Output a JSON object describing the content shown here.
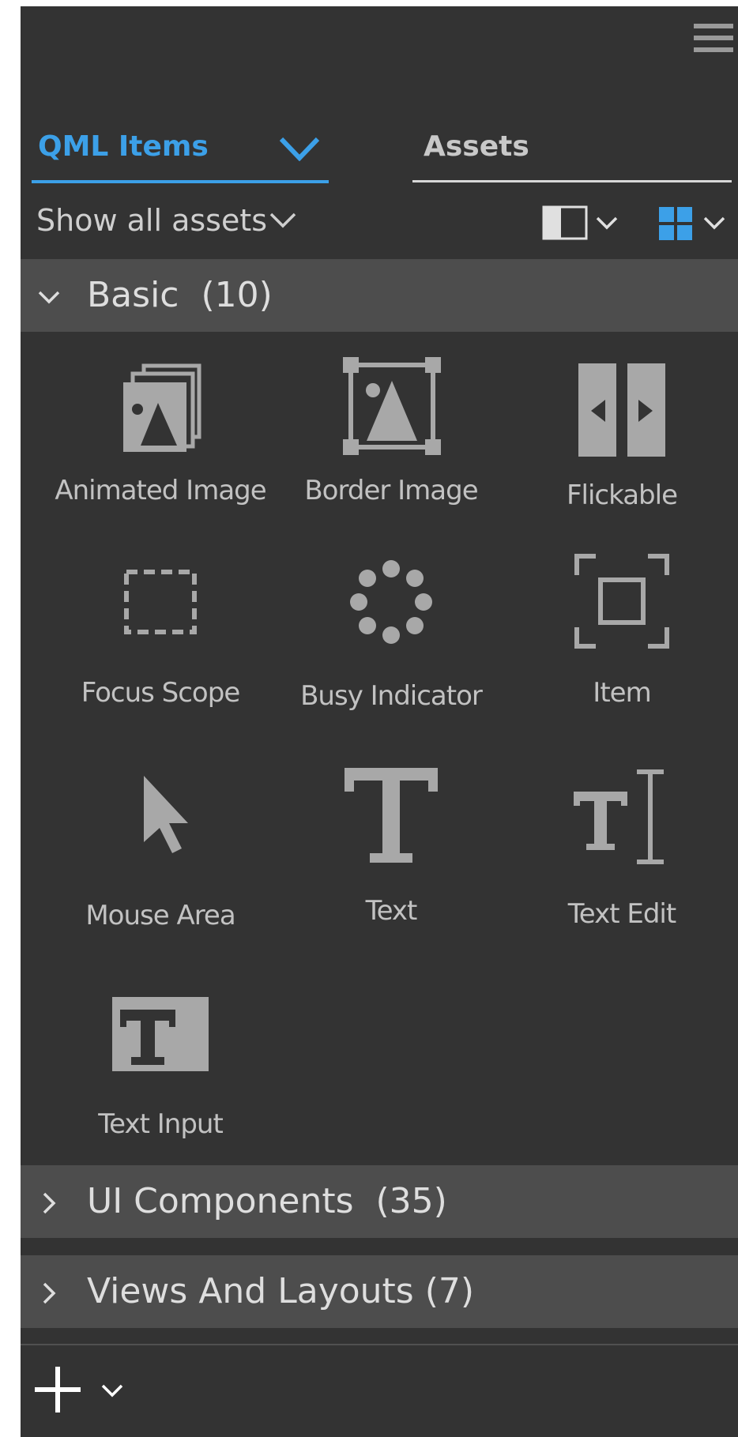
{
  "tabs": [
    {
      "label": "QML Items",
      "active": true
    },
    {
      "label": "Assets",
      "active": false
    }
  ],
  "filter": {
    "label": "Show all assets"
  },
  "categories": [
    {
      "label": "Basic  (10)",
      "expanded": true
    },
    {
      "label": "UI Components  (35)",
      "expanded": false
    },
    {
      "label": "Views And Layouts (7)",
      "expanded": false
    }
  ],
  "items": [
    {
      "label": "Animated Image",
      "icon": "animated-image-icon"
    },
    {
      "label": "Border Image",
      "icon": "border-image-icon"
    },
    {
      "label": "Flickable",
      "icon": "flickable-icon"
    },
    {
      "label": "Focus Scope",
      "icon": "focus-scope-icon"
    },
    {
      "label": "Busy Indicator",
      "icon": "busy-indicator-icon"
    },
    {
      "label": "Item",
      "icon": "item-icon"
    },
    {
      "label": "Mouse Area",
      "icon": "mouse-area-icon"
    },
    {
      "label": "Text",
      "icon": "text-icon"
    },
    {
      "label": "Text Edit",
      "icon": "text-edit-icon"
    },
    {
      "label": "Text Input",
      "icon": "text-input-icon"
    }
  ],
  "colors": {
    "panel": "#333333",
    "category_header": "#4d4d4d",
    "accent": "#3ca0e8",
    "icon": "#a8a8a8"
  }
}
